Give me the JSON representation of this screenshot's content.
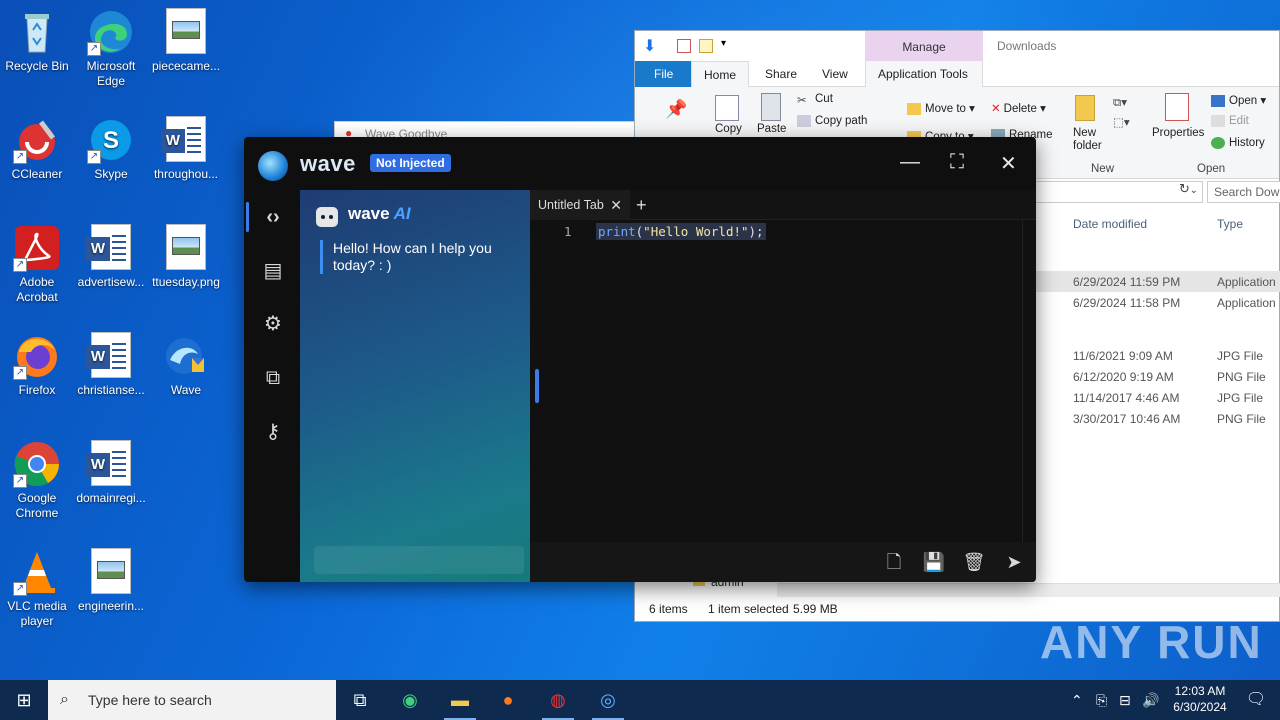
{
  "desktop": {
    "icons": [
      {
        "label": "Recycle Bin"
      },
      {
        "label": "Microsoft Edge"
      },
      {
        "label": "piececame..."
      },
      {
        "label": "CCleaner"
      },
      {
        "label": "Skype"
      },
      {
        "label": "throughou..."
      },
      {
        "label": "Adobe Acrobat"
      },
      {
        "label": "advertisew..."
      },
      {
        "label": "ttuesday.png"
      },
      {
        "label": "Firefox"
      },
      {
        "label": "christianse..."
      },
      {
        "label": "Wave"
      },
      {
        "label": "Google Chrome"
      },
      {
        "label": "domainregi..."
      },
      {
        "label": "VLC media player"
      },
      {
        "label": "engineerin..."
      }
    ]
  },
  "explorer": {
    "manage_tab": "Manage",
    "title": "Downloads",
    "tabs": {
      "file": "File",
      "home": "Home",
      "share": "Share",
      "view": "View",
      "app_tools": "Application Tools"
    },
    "ribbon": {
      "copy": "Copy",
      "paste": "Paste",
      "cut": "Cut",
      "copy_path": "Copy path",
      "move_to": "Move to",
      "copy_to": "Copy to",
      "delete": "Delete",
      "rename": "Rename",
      "new_folder": "New folder",
      "new_group": "New",
      "properties": "Properties",
      "open": "Open",
      "edit": "Edit",
      "history": "History",
      "open_group": "Open"
    },
    "search_placeholder": "Search Down",
    "columns": {
      "date": "Date modified",
      "type": "Type"
    },
    "files": [
      {
        "date": "6/29/2024 11:59 PM",
        "type": "Application",
        "selected": true
      },
      {
        "date": "6/29/2024 11:58 PM",
        "type": "Application",
        "selected": false
      },
      {
        "date": "11/6/2021 9:09 AM",
        "type": "JPG File",
        "selected": false
      },
      {
        "date": "6/12/2020 9:19 AM",
        "type": "PNG File",
        "selected": false
      },
      {
        "date": "11/14/2017 4:46 AM",
        "type": "JPG File",
        "selected": false
      },
      {
        "date": "3/30/2017 10:46 AM",
        "type": "PNG File",
        "selected": false
      }
    ],
    "nav_item": "admin",
    "status": {
      "items": "6 items",
      "selected": "1 item selected",
      "size": "5.99 MB"
    }
  },
  "ghost_window": {
    "title": "Wave Goodbye"
  },
  "wave": {
    "name": "wave",
    "badge": "Not Injected",
    "ai": {
      "title": "wave",
      "title_ai": "AI",
      "message": "Hello! How can I help you today? : )"
    },
    "tab": {
      "label": "Untitled Tab"
    },
    "editor": {
      "line_number": "1",
      "code_fn": "print",
      "code_open": "(",
      "code_str": "\"Hello World!\"",
      "code_close": ");"
    }
  },
  "watermark": "ANY RUN",
  "taskbar": {
    "search_placeholder": "Type here to search",
    "time": "12:03 AM",
    "date": "6/30/2024"
  },
  "colors": {
    "wave_accent": "#3a7de8",
    "badge": "#2f6de0",
    "explorer_file_tab": "#1979ca",
    "manage": "#e9d3ef"
  }
}
